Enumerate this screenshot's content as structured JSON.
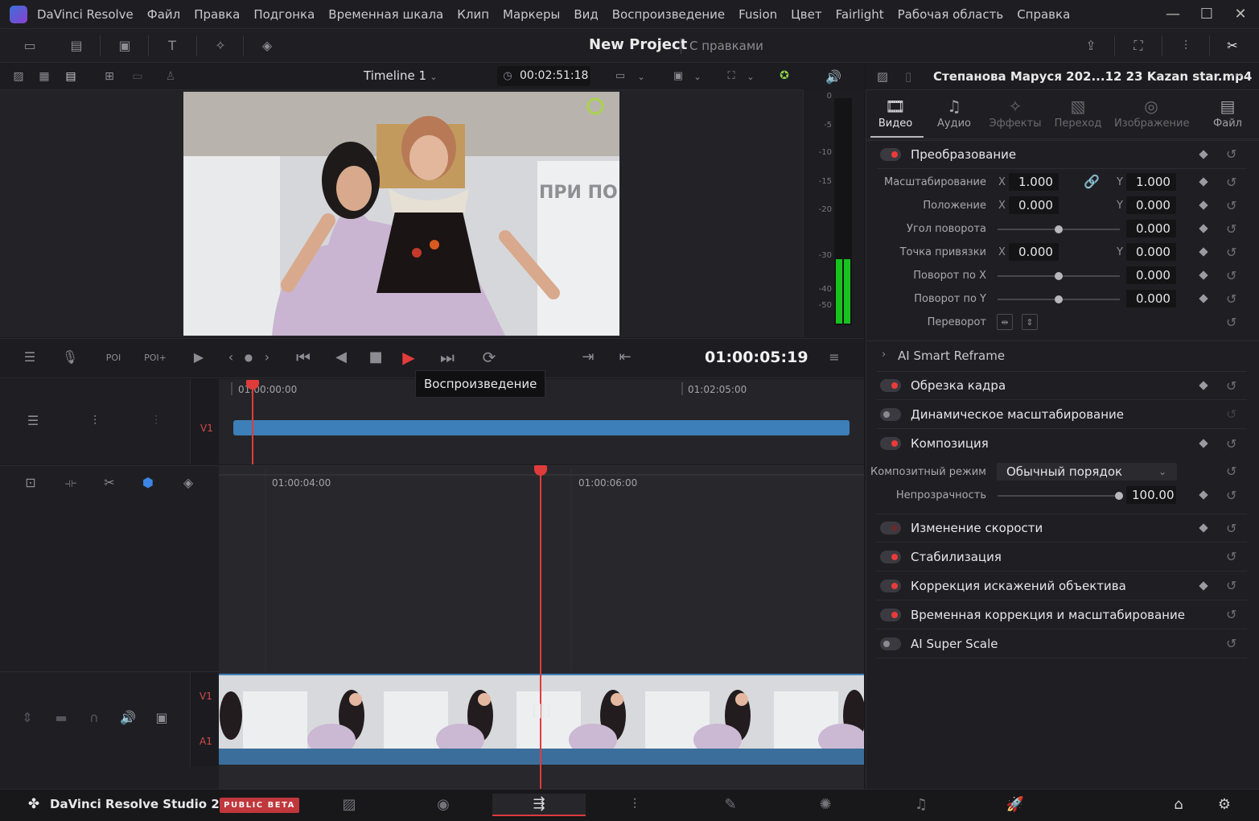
{
  "titlebar": {
    "app_name": "DaVinci Resolve",
    "menu": [
      "Файл",
      "Правка",
      "Подгонка",
      "Временная шкала",
      "Клип",
      "Маркеры",
      "Вид",
      "Воспроизведение",
      "Fusion",
      "Цвет",
      "Fairlight",
      "Рабочая область",
      "Справка"
    ],
    "minimize": "—",
    "maximize": "☐",
    "close": "✕"
  },
  "toolbar": {
    "project_title": "New Project",
    "project_status": "С правками"
  },
  "viewer": {
    "timeline_name": "Timeline 1",
    "source_timecode": "00:02:51:18",
    "overlay_text": "ПРИ ПО"
  },
  "meter": {
    "labels": [
      "0",
      "-5",
      "-10",
      "-15",
      "-20",
      "-30",
      "-40",
      "-50"
    ]
  },
  "transport": {
    "timecode": "01:00:05:19",
    "tooltip": "Воспроизведение"
  },
  "timeline_upper": {
    "track_label": "V1",
    "ruler": [
      "01:00:00:00",
      "01:02:05:00"
    ]
  },
  "timeline_lower": {
    "ruler": [
      "01:00:04:00",
      "01:00:06:00"
    ],
    "track_video": "V1",
    "track_audio": "A1"
  },
  "inspector": {
    "clip_name": "Степанова Маруся 202...12 23 Kazan star.mp4",
    "more": "···",
    "tabs": [
      {
        "label": "Видео",
        "icon": "film-icon",
        "active": true
      },
      {
        "label": "Аудио",
        "icon": "music-note-icon",
        "active": false
      },
      {
        "label": "Эффекты",
        "icon": "wand-icon",
        "active": false
      },
      {
        "label": "Переход",
        "icon": "transition-icon",
        "active": false
      },
      {
        "label": "Изображение",
        "icon": "image-icon",
        "active": false
      },
      {
        "label": "Файл",
        "icon": "file-icon",
        "active": false
      }
    ],
    "transform": {
      "title": "Преобразование",
      "zoom_label": "Масштабирование",
      "zoom_x": "1.000",
      "zoom_y": "1.000",
      "position_label": "Положение",
      "position_x": "0.000",
      "position_y": "0.000",
      "rotation_label": "Угол поворота",
      "rotation": "0.000",
      "anchor_label": "Точка привязки",
      "anchor_x": "0.000",
      "anchor_y": "0.000",
      "pitch_label": "Поворот по X",
      "pitch": "0.000",
      "yaw_label": "Поворот по Y",
      "yaw": "0.000",
      "flip_label": "Переворот",
      "x": "X",
      "y": "Y"
    },
    "smart_reframe": "AI Smart Reframe",
    "cropping": "Обрезка кадра",
    "dynamic_zoom": "Динамическое масштабирование",
    "composite": {
      "title": "Композиция",
      "mode_label": "Композитный режим",
      "mode_value": "Обычный порядок",
      "opacity_label": "Непрозрачность",
      "opacity_value": "100.00"
    },
    "speed_change": "Изменение скорости",
    "stabilization": "Стабилизация",
    "lens_correction": "Коррекция искажений объектива",
    "retime_scaling": "Временная коррекция и масштабирование",
    "super_scale": "AI Super Scale"
  },
  "bottombar": {
    "brand": "DaVinci Resolve Studio 21",
    "badge": "PUBLIC BETA",
    "pages": [
      "media-page-icon",
      "cut-page-icon",
      "edit-page-icon",
      "fusion-page-icon",
      "color-page-icon",
      "fairlight-page-icon",
      "deliver-page-icon"
    ]
  },
  "colors": {
    "accent_red": "#e03b3b",
    "clip_blue": "#3d7fb8",
    "meter_green": "#19c11f",
    "badge_red": "#c0373c"
  }
}
